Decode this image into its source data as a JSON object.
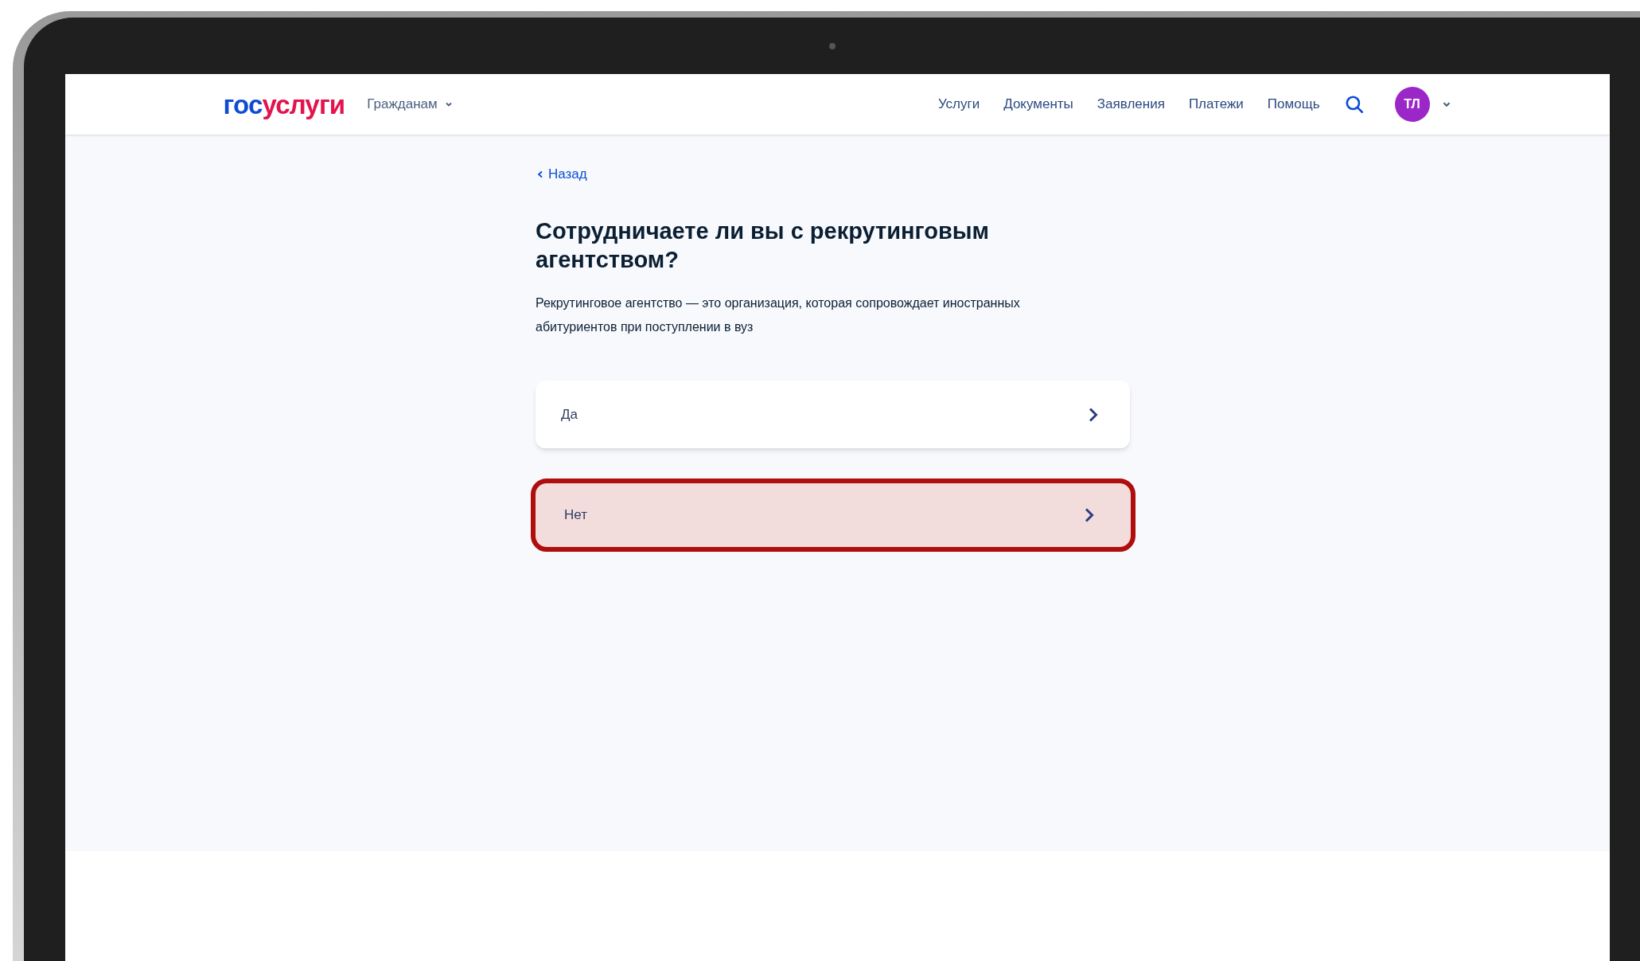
{
  "header": {
    "logo": {
      "part_1": "гос",
      "part_2": "услуги"
    },
    "audience_menu": "Гражданам",
    "nav": [
      "Услуги",
      "Документы",
      "Заявления",
      "Платежи",
      "Помощь"
    ],
    "avatar": "ТЛ"
  },
  "back_link": "Назад",
  "question": "Сотрудничаете ли вы с рекрутинговым агентством?",
  "description": "Рекрутинговое агентство — это организация, которая сопровождает иностранных абитуриентов при поступлении в вуз",
  "options": [
    {
      "label": "Да",
      "selected": false
    },
    {
      "label": "Нет",
      "selected": true
    }
  ]
}
